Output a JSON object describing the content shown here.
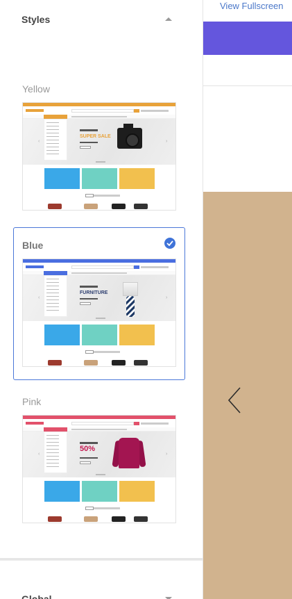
{
  "styles_section": {
    "title": "Styles",
    "options": [
      {
        "label": "Yellow",
        "selected": false,
        "accent": "#e8a23a",
        "hero_text": "SUPER SALE",
        "hero_text_color": "#e8a23a"
      },
      {
        "label": "Blue",
        "selected": true,
        "accent": "#4a6ee0",
        "hero_text": "FURNITURE",
        "hero_text_color": "#2e3f70"
      },
      {
        "label": "Pink",
        "selected": false,
        "accent": "#e2516b",
        "hero_text": "50%",
        "hero_text_color": "#c4174f"
      }
    ]
  },
  "global_section": {
    "title": "Global"
  },
  "preview": {
    "fullscreen_label": "View Fullscreen",
    "bar_color": "#6456dd",
    "background_color": "#d1b38e"
  },
  "tile_colors": [
    "#3aa8e8",
    "#6fd1c3",
    "#f2c04e"
  ]
}
